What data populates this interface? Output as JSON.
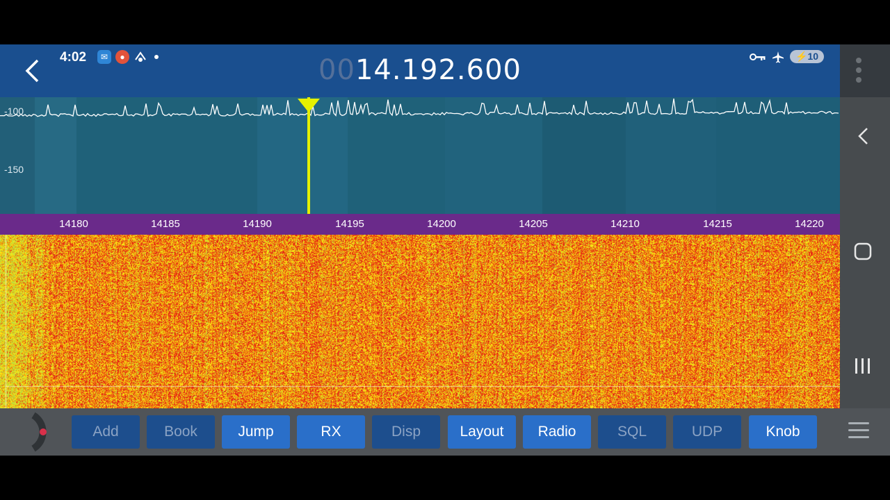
{
  "status_bar": {
    "time": "4:02",
    "battery": "10",
    "icons": [
      "mail-app-icon",
      "recorder-app-icon",
      "radio-app-icon",
      "dot-icon",
      "vpn-key-icon",
      "airplane-mode-icon",
      "battery-charging-icon"
    ]
  },
  "header": {
    "freq_prefix": "00",
    "freq_main": "14.192.600"
  },
  "spectrum": {
    "db_labels": [
      "-100",
      "-150"
    ]
  },
  "freq_axis": {
    "ticks": [
      "14180",
      "14185",
      "14190",
      "14195",
      "14200",
      "14205",
      "14210",
      "14215",
      "14220"
    ]
  },
  "toolbar": {
    "buttons": [
      {
        "label": "Add",
        "active": false
      },
      {
        "label": "Book",
        "active": false
      },
      {
        "label": "Jump",
        "active": true
      },
      {
        "label": "RX",
        "active": true
      },
      {
        "label": "Disp",
        "active": false
      },
      {
        "label": "Layout",
        "active": true
      },
      {
        "label": "Radio",
        "active": true
      },
      {
        "label": "SQL",
        "active": false
      },
      {
        "label": "UDP",
        "active": false
      },
      {
        "label": "Knob",
        "active": true
      }
    ]
  },
  "colors": {
    "header": "#1a4f8f",
    "spectrum_bg": "#1e5f78",
    "freq_axis_bg": "#6a2a8a",
    "button_active": "#2a6fc9",
    "button_inactive": "#1d4e8d",
    "tuning_marker": "#e6f000"
  }
}
